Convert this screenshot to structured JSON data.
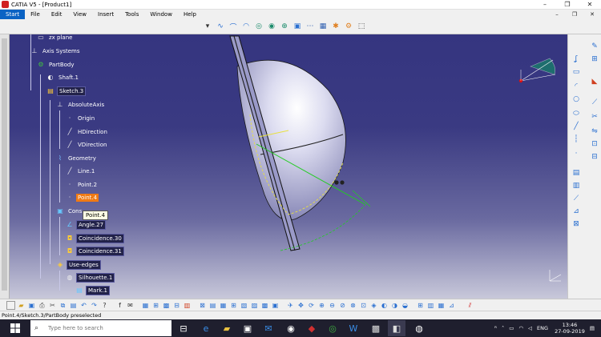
{
  "window": {
    "title": "CATIA V5 - [Product1]",
    "controls": [
      "–",
      "❐",
      "✕"
    ],
    "doc_controls": [
      "–",
      "❐",
      "✕"
    ]
  },
  "menu": {
    "items": [
      "Start",
      "File",
      "Edit",
      "View",
      "Insert",
      "Tools",
      "Window",
      "Help"
    ]
  },
  "tree": {
    "nodes": [
      {
        "label": "zx plane",
        "icon": "plane-icon"
      },
      {
        "label": "Axis Systems",
        "icon": "axis-system-icon"
      },
      {
        "label": "PartBody",
        "icon": "partbody-icon"
      },
      {
        "label": "Shaft.1",
        "icon": "shaft-icon"
      },
      {
        "label": "Sketch.3",
        "icon": "sketch-icon"
      },
      {
        "label": "AbsoluteAxis",
        "icon": "axis-icon"
      },
      {
        "label": "Origin",
        "icon": "point-icon"
      },
      {
        "label": "HDirection",
        "icon": "line-icon"
      },
      {
        "label": "VDirection",
        "icon": "line-icon"
      },
      {
        "label": "Geometry",
        "icon": "geometry-icon"
      },
      {
        "label": "Line.1",
        "icon": "line-icon"
      },
      {
        "label": "Point.2",
        "icon": "point-icon"
      },
      {
        "label": "Point.4",
        "icon": "point-icon"
      },
      {
        "label": "Cons",
        "icon": "constraints-icon"
      },
      {
        "label": "Angle.27",
        "icon": "angle-icon"
      },
      {
        "label": "Coincidence.30",
        "icon": "coincidence-icon"
      },
      {
        "label": "Coincidence.31",
        "icon": "coincidence-icon"
      },
      {
        "label": "Use-edges",
        "icon": "use-edges-icon"
      },
      {
        "label": "Silhouette.1",
        "icon": "silhouette-icon"
      },
      {
        "label": "Mark.1",
        "icon": "mark-icon"
      }
    ],
    "tooltip": "Point.4"
  },
  "status": {
    "text": "Point.4/Sketch.3/PartBody preselected"
  },
  "taskbar": {
    "search_placeholder": "Type here to search",
    "language": "ENG",
    "time": "13:46",
    "date": "27-09-2019"
  },
  "colors": {
    "viewport_top": "#353580",
    "viewport_bottom": "#c8c8da",
    "highlight": "#f07a14",
    "sketch_green": "#22cc22"
  }
}
